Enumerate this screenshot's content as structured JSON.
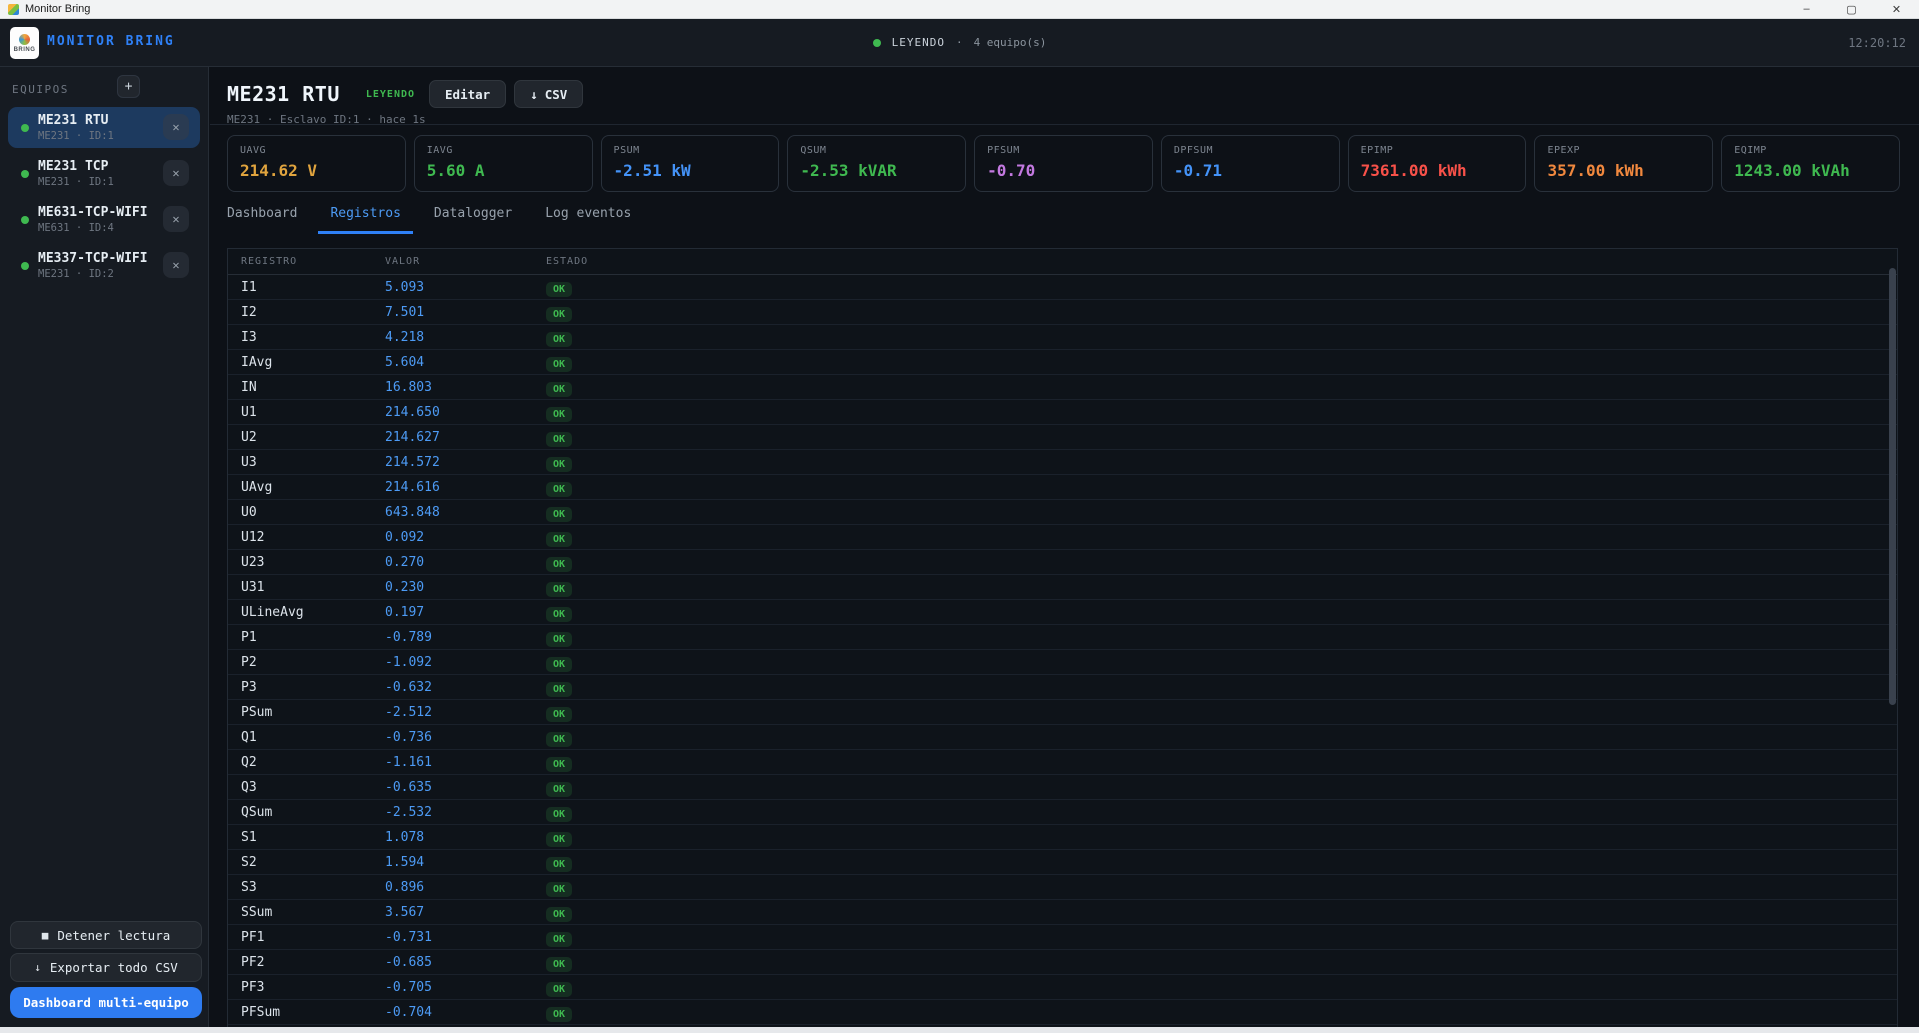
{
  "window": {
    "title": "Monitor Bring",
    "controls": {
      "minimize": "–",
      "maximize": "▢",
      "close": "✕"
    }
  },
  "header": {
    "brand": "MONITOR BRING",
    "logo_word": "BRING",
    "status": {
      "label": "LEYENDO",
      "separator": "·",
      "count": "4 equipo(s)"
    },
    "clock": "12:20:12"
  },
  "sidebar": {
    "section_label": "EQUIPOS",
    "add_label": "+",
    "devices": [
      {
        "name": "ME231 RTU",
        "meta": "ME231 · ID:1",
        "close": "✕",
        "selected": true
      },
      {
        "name": "ME231 TCP",
        "meta": "ME231 · ID:1",
        "close": "✕",
        "selected": false
      },
      {
        "name": "ME631-TCP-WIFI",
        "meta": "ME631 · ID:4",
        "close": "✕",
        "selected": false
      },
      {
        "name": "ME337-TCP-WIFI",
        "meta": "ME231 · ID:2",
        "close": "✕",
        "selected": false
      }
    ],
    "stop_button": {
      "icon": "■",
      "label": "Detener lectura"
    },
    "export_button": {
      "icon": "↓",
      "label": "Exportar todo CSV"
    },
    "dashboard_button": "Dashboard multi-equipo"
  },
  "page": {
    "title": "ME231 RTU",
    "badge": "LEYENDO",
    "subtitle": "ME231 · Esclavo ID:1 · hace 1s",
    "edit_button": "Editar",
    "csv_button": {
      "icon": "↓",
      "label": "CSV"
    }
  },
  "stats": [
    {
      "label": "UAVG",
      "value": "214.62 V",
      "color": "#e0a43e"
    },
    {
      "label": "IAVG",
      "value": "5.60 A",
      "color": "#3fb950"
    },
    {
      "label": "PSUM",
      "value": "-2.51 kW",
      "color": "#4493f8"
    },
    {
      "label": "QSUM",
      "value": "-2.53 kVAR",
      "color": "#3fb950"
    },
    {
      "label": "PFSUM",
      "value": "-0.70",
      "color": "#c379e0"
    },
    {
      "label": "DPFSUM",
      "value": "-0.71",
      "color": "#4493f8"
    },
    {
      "label": "EPIMP",
      "value": "7361.00 kWh",
      "color": "#f85149"
    },
    {
      "label": "EPEXP",
      "value": "357.00 kWh",
      "color": "#f0883e"
    },
    {
      "label": "EQIMP",
      "value": "1243.00 kVAh",
      "color": "#3fb950"
    }
  ],
  "tabs": [
    {
      "label": "Dashboard",
      "active": false
    },
    {
      "label": "Registros",
      "active": true
    },
    {
      "label": "Datalogger",
      "active": false
    },
    {
      "label": "Log eventos",
      "active": false
    }
  ],
  "table": {
    "columns": [
      "REGISTRO",
      "VALOR",
      "ESTADO"
    ],
    "rows": [
      {
        "name": "I1",
        "value": "5.093",
        "status": "OK"
      },
      {
        "name": "I2",
        "value": "7.501",
        "status": "OK"
      },
      {
        "name": "I3",
        "value": "4.218",
        "status": "OK"
      },
      {
        "name": "IAvg",
        "value": "5.604",
        "status": "OK"
      },
      {
        "name": "IN",
        "value": "16.803",
        "status": "OK"
      },
      {
        "name": "U1",
        "value": "214.650",
        "status": "OK"
      },
      {
        "name": "U2",
        "value": "214.627",
        "status": "OK"
      },
      {
        "name": "U3",
        "value": "214.572",
        "status": "OK"
      },
      {
        "name": "UAvg",
        "value": "214.616",
        "status": "OK"
      },
      {
        "name": "U0",
        "value": "643.848",
        "status": "OK"
      },
      {
        "name": "U12",
        "value": "0.092",
        "status": "OK"
      },
      {
        "name": "U23",
        "value": "0.270",
        "status": "OK"
      },
      {
        "name": "U31",
        "value": "0.230",
        "status": "OK"
      },
      {
        "name": "ULineAvg",
        "value": "0.197",
        "status": "OK"
      },
      {
        "name": "P1",
        "value": "-0.789",
        "status": "OK"
      },
      {
        "name": "P2",
        "value": "-1.092",
        "status": "OK"
      },
      {
        "name": "P3",
        "value": "-0.632",
        "status": "OK"
      },
      {
        "name": "PSum",
        "value": "-2.512",
        "status": "OK"
      },
      {
        "name": "Q1",
        "value": "-0.736",
        "status": "OK"
      },
      {
        "name": "Q2",
        "value": "-1.161",
        "status": "OK"
      },
      {
        "name": "Q3",
        "value": "-0.635",
        "status": "OK"
      },
      {
        "name": "QSum",
        "value": "-2.532",
        "status": "OK"
      },
      {
        "name": "S1",
        "value": "1.078",
        "status": "OK"
      },
      {
        "name": "S2",
        "value": "1.594",
        "status": "OK"
      },
      {
        "name": "S3",
        "value": "0.896",
        "status": "OK"
      },
      {
        "name": "SSum",
        "value": "3.567",
        "status": "OK"
      },
      {
        "name": "PF1",
        "value": "-0.731",
        "status": "OK"
      },
      {
        "name": "PF2",
        "value": "-0.685",
        "status": "OK"
      },
      {
        "name": "PF3",
        "value": "-0.705",
        "status": "OK"
      },
      {
        "name": "PFSum",
        "value": "-0.704",
        "status": "OK"
      }
    ]
  }
}
